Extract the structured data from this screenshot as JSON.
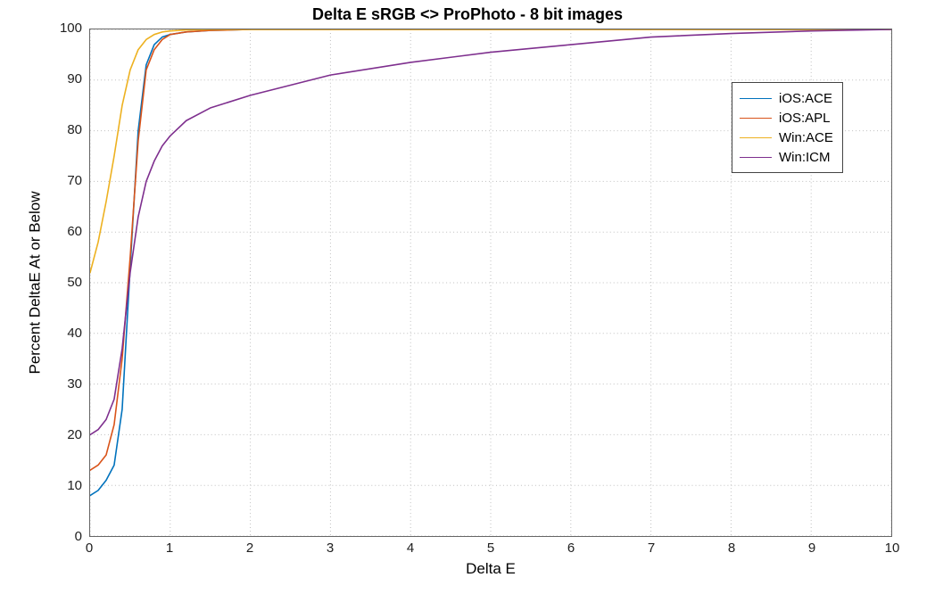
{
  "chart_data": {
    "type": "line",
    "title": "Delta E sRGB <> ProPhoto - 8 bit images",
    "xlabel": "Delta E",
    "ylabel": "Percent DeltaE At or Below",
    "xlim": [
      0,
      10
    ],
    "ylim": [
      0,
      100
    ],
    "grid": true,
    "legend_position": "northeast",
    "series": [
      {
        "name": "iOS:ACE",
        "color": "#0072BD",
        "x": [
          0,
          0.1,
          0.2,
          0.3,
          0.4,
          0.5,
          0.6,
          0.7,
          0.8,
          0.9,
          1.0,
          1.2,
          1.5,
          2.0,
          3.0,
          5.0,
          10.0
        ],
        "y": [
          8,
          9,
          11,
          14,
          25,
          53,
          80,
          93,
          97,
          98.5,
          99,
          99.5,
          99.8,
          100,
          100,
          100,
          100
        ]
      },
      {
        "name": "iOS:APL",
        "color": "#D95319",
        "x": [
          0,
          0.1,
          0.2,
          0.3,
          0.4,
          0.5,
          0.6,
          0.7,
          0.8,
          0.9,
          1.0,
          1.2,
          1.5,
          2.0,
          3.0,
          5.0,
          10.0
        ],
        "y": [
          13,
          14,
          16,
          22,
          35,
          55,
          78,
          92,
          96,
          98,
          99,
          99.5,
          99.8,
          100,
          100,
          100,
          100
        ]
      },
      {
        "name": "Win:ACE",
        "color": "#EDB120",
        "x": [
          0,
          0.1,
          0.2,
          0.3,
          0.4,
          0.5,
          0.6,
          0.7,
          0.8,
          0.9,
          1.0,
          1.2,
          1.5,
          2.0,
          3.0,
          5.0,
          10.0
        ],
        "y": [
          52,
          58,
          66,
          75,
          85,
          92,
          96,
          98,
          99,
          99.5,
          99.7,
          99.9,
          100,
          100,
          100,
          100,
          100
        ]
      },
      {
        "name": "Win:ICM",
        "color": "#7E2F8E",
        "x": [
          0,
          0.1,
          0.2,
          0.3,
          0.4,
          0.5,
          0.6,
          0.7,
          0.8,
          0.9,
          1.0,
          1.2,
          1.5,
          2.0,
          2.5,
          3.0,
          4.0,
          5.0,
          6.0,
          7.0,
          8.0,
          9.0,
          10.0
        ],
        "y": [
          20,
          21,
          23,
          27,
          37,
          52,
          63,
          70,
          74,
          77,
          79,
          82,
          84.5,
          87,
          89,
          91,
          93.5,
          95.5,
          97,
          98.5,
          99.2,
          99.7,
          100
        ]
      }
    ]
  },
  "ticks": {
    "x": [
      0,
      1,
      2,
      3,
      4,
      5,
      6,
      7,
      8,
      9,
      10
    ],
    "y": [
      0,
      10,
      20,
      30,
      40,
      50,
      60,
      70,
      80,
      90,
      100
    ]
  }
}
